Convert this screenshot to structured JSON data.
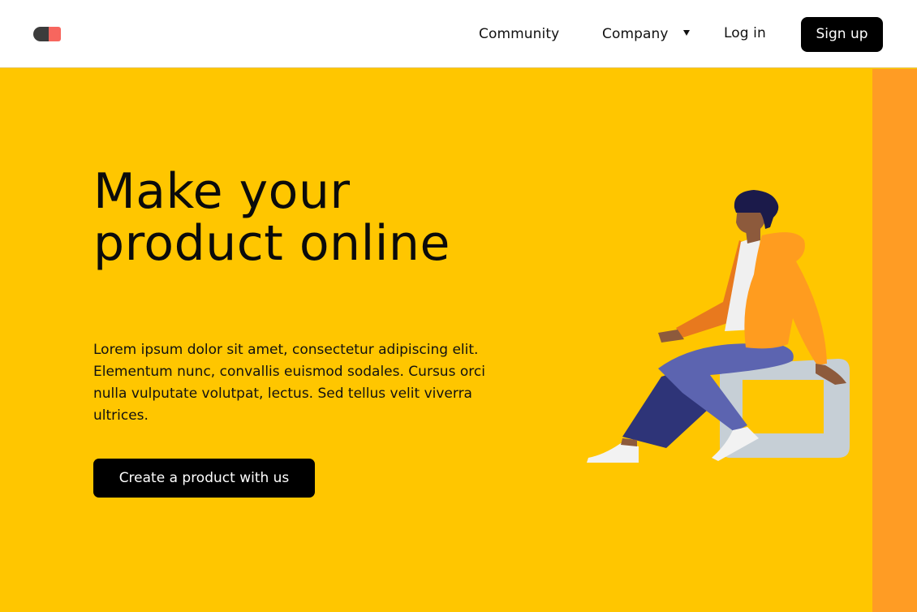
{
  "nav": {
    "links": [
      {
        "label": "Community"
      },
      {
        "label": "Company",
        "has_dropdown": true
      },
      {
        "label": "Log in"
      }
    ],
    "signup_label": "Sign up"
  },
  "hero": {
    "title": "Make your product online",
    "description": "Lorem ipsum dolor sit amet, consectetur adipiscing elit. Elementum nunc, convallis euismod sodales. Cursus orci nulla vulputate volutpat, lectus. Sed tellus velit viverra ultrices.",
    "cta_label": "Create a product with us"
  },
  "icons": {
    "logo": "toggle-pill-logo-icon",
    "dropdown": "caret-down-icon",
    "illustration": "person-sitting-on-frame"
  },
  "colors": {
    "background": "#ffc600",
    "side_strip": "#ff9c24",
    "logo_accent": "#f7665e",
    "button": "#000000"
  }
}
